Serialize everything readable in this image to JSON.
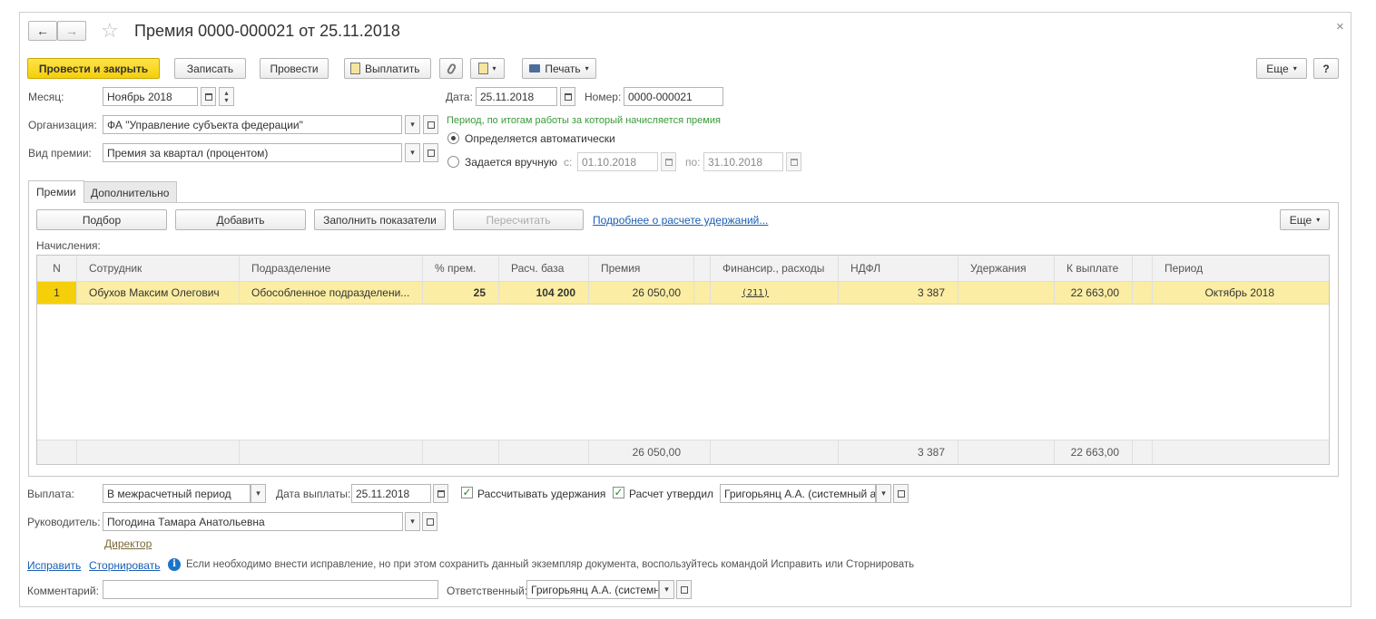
{
  "window": {
    "title": "Премия 0000-000021 от 25.11.2018",
    "close": "×",
    "back_icon": "←",
    "forward_icon": "→",
    "star_icon": "☆"
  },
  "toolbar": {
    "post_close": "Провести и закрыть",
    "save": "Записать",
    "post": "Провести",
    "pay": "Выплатить",
    "print": "Печать",
    "more": "Еще",
    "help": "?"
  },
  "header": {
    "month_label": "Месяц:",
    "month_value": "Ноябрь 2018",
    "date_label": "Дата:",
    "date_value": "25.11.2018",
    "number_label": "Номер:",
    "number_value": "0000-000021",
    "org_label": "Организация:",
    "org_value": "ФА \"Управление субъекта федерации\"",
    "bonus_type_label": "Вид премии:",
    "bonus_type_value": "Премия за квартал (процентом)",
    "period_caption": "Период, по итогам работы за который начисляется премия",
    "auto_option": "Определяется автоматически",
    "manual_option": "Задается вручную",
    "from_label": "с:",
    "from_value": "01.10.2018",
    "to_label": "по:",
    "to_value": "31.10.2018"
  },
  "tabs": [
    {
      "label": "Премии"
    },
    {
      "label": "Дополнительно"
    }
  ],
  "tab_toolbar": {
    "select": "Подбор",
    "add": "Добавить",
    "fill": "Заполнить показатели",
    "recalc": "Пересчитать",
    "details_link": "Подробнее о расчете удержаний...",
    "more": "Еще"
  },
  "accruals_label": "Начисления:",
  "table": {
    "columns": [
      "N",
      "Сотрудник",
      "Подразделение",
      "% прем.",
      "Расч. база",
      "Премия",
      "Финансир., расходы",
      "НДФЛ",
      "Удержания",
      "К выплате",
      "Период"
    ],
    "rows": [
      {
        "n": "1",
        "employee": "Обухов Максим Олегович",
        "department": "Обособленное подразделени...",
        "percent": "25",
        "base": "104 200",
        "bonus": "26 050,00",
        "finance": "(211)",
        "ndfl": "3 387",
        "deductions": "",
        "payout": "22 663,00",
        "period": "Октябрь 2018"
      }
    ],
    "totals": {
      "bonus": "26 050,00",
      "ndfl": "3 387",
      "payout": "22 663,00"
    }
  },
  "footer": {
    "payment_label": "Выплата:",
    "payment_value": "В межрасчетный период",
    "pay_date_label": "Дата выплаты:",
    "pay_date_value": "25.11.2018",
    "calc_deductions": "Рассчитывать удержания",
    "calc_approved": "Расчет утвердил",
    "approver_value": "Григорьянц А.А. (системный адм",
    "manager_label": "Руководитель:",
    "manager_value": "Погодина Тамара Анатольевна",
    "manager_position": "Директор",
    "fix_link": "Исправить",
    "reverse_link": "Сторнировать",
    "info_text": "Если необходимо внести исправление, но при этом сохранить данный экземпляр документа, воспользуйтесь командой Исправить или Сторнировать",
    "comment_label": "Комментарий:",
    "comment_value": "",
    "responsible_label": "Ответственный:",
    "responsible_value": "Григорьянц А.А. (системн"
  },
  "colors": {
    "primary_button": "#f5cf0a",
    "selected_row": "#fbeda3",
    "link": "#1a5fb4",
    "period_caption": "#3a9a3a"
  }
}
